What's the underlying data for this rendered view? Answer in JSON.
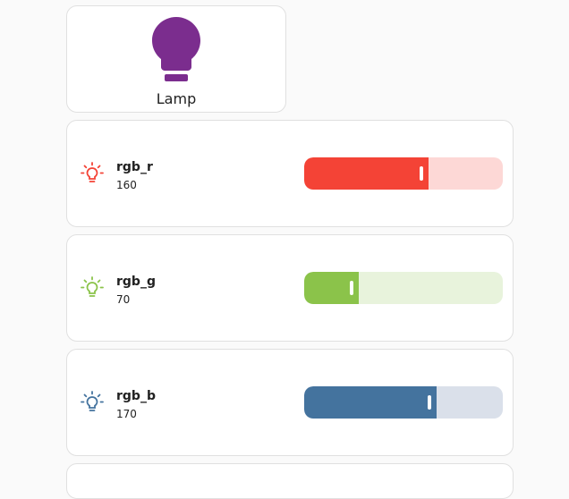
{
  "lamp": {
    "name": "Lamp",
    "color": "#7b2d8e",
    "icon": "lightbulb-icon"
  },
  "rows": [
    {
      "name": "rgb_r",
      "value": "160",
      "level_fraction": 0.627,
      "color": "#f44336",
      "track_color": "#fdd8d6",
      "icon": "lightbulb-outline-icon"
    },
    {
      "name": "rgb_g",
      "value": "70",
      "level_fraction": 0.275,
      "color": "#8bc34a",
      "track_color": "#e8f3dc",
      "icon": "lightbulb-outline-icon"
    },
    {
      "name": "rgb_b",
      "value": "170",
      "level_fraction": 0.667,
      "color": "#44739e",
      "track_color": "#dae0ea",
      "icon": "lightbulb-outline-icon"
    }
  ]
}
